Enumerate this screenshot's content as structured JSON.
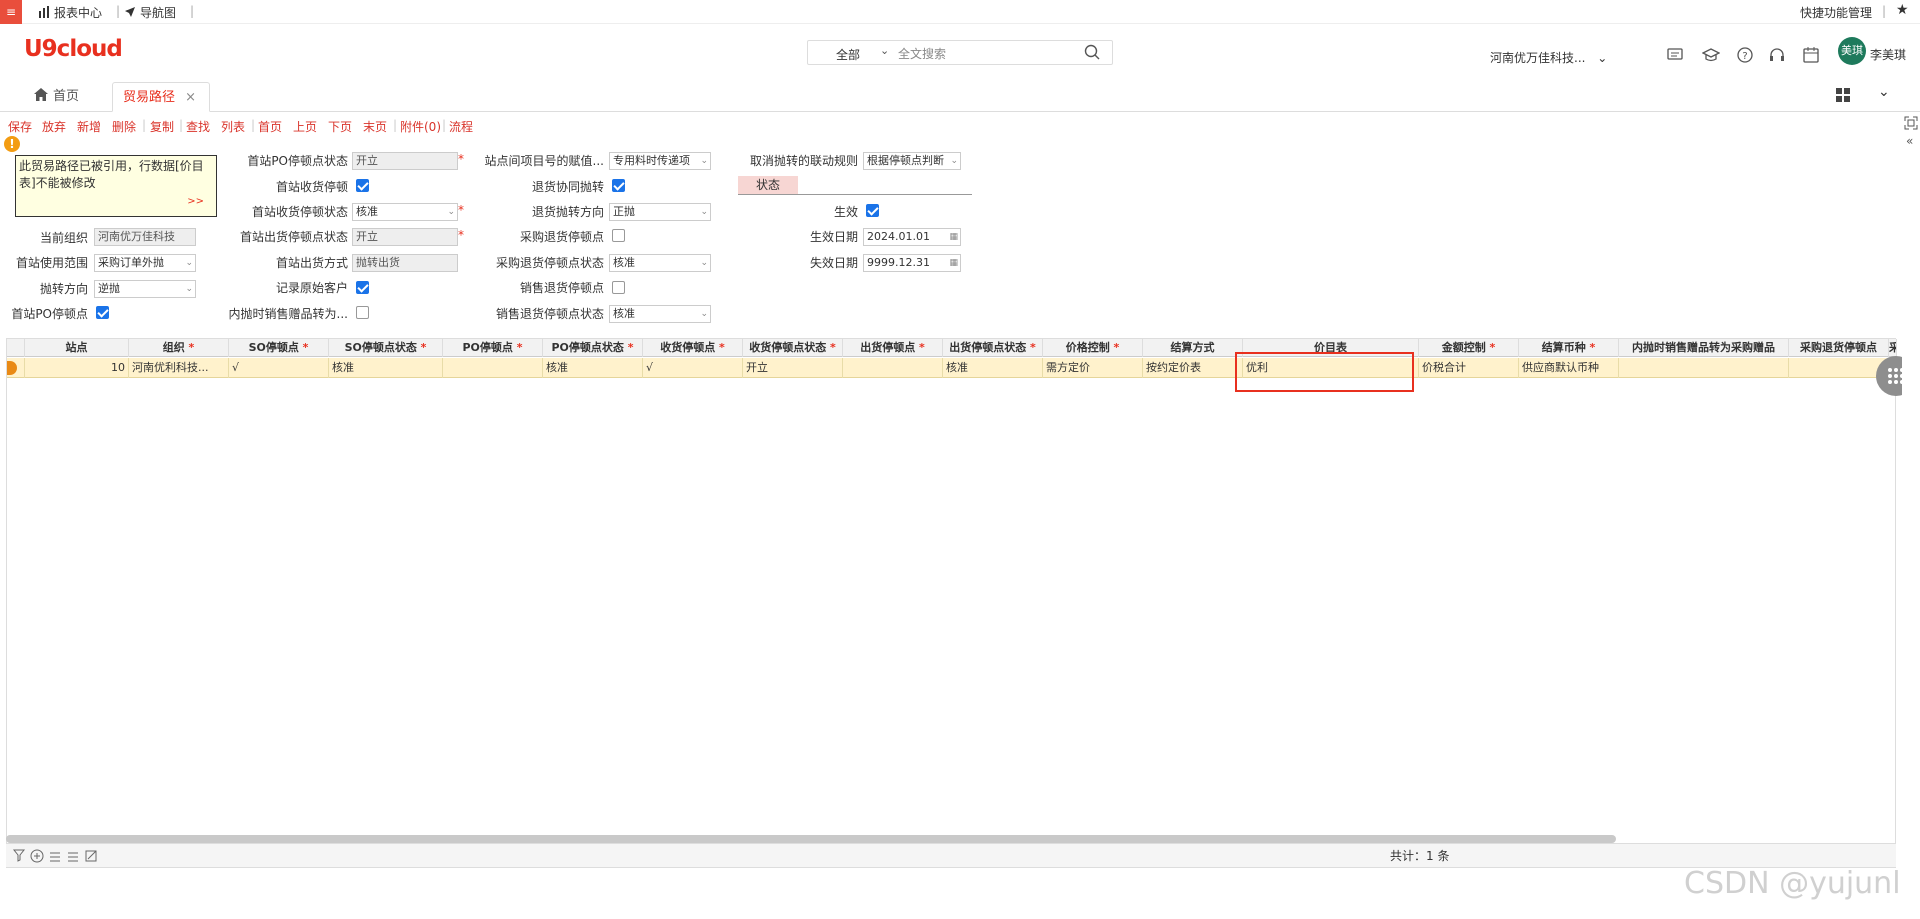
{
  "topbar": {
    "menu_icon": "≡",
    "reports": "报表中心",
    "nav": "导航图",
    "quick": "快捷功能管理",
    "star": "★"
  },
  "header": {
    "logo": "U9cloud",
    "search_scope": "全部",
    "search_placeholder": "全文搜索",
    "org": "河南优万佳科技...",
    "avatar_text": "美琪",
    "user": "李美琪"
  },
  "tabs": [
    {
      "label": "首页"
    },
    {
      "label": "贸易路径"
    }
  ],
  "toolbar": [
    "保存",
    "放弃",
    "新增",
    "删除",
    "复制",
    "查找",
    "列表",
    "首页",
    "上页",
    "下页",
    "末页",
    "附件(0)",
    "流程"
  ],
  "warning": {
    "text": "此贸易路径已被引用，行数据[价目表]不能被修改",
    "more": ">>"
  },
  "form": {
    "col1": {
      "current_org_label": "当前组织",
      "current_org": "河南优万佳科技",
      "first_use_label": "首站使用范围",
      "first_use": "采购订单外抛",
      "toss_dir_label": "抛转方向",
      "toss_dir": "逆抛",
      "first_po_stop_label": "首站PO停顿点"
    },
    "col2": {
      "po_stop_state_label": "首站PO停顿点状态",
      "po_stop_state": "开立",
      "recv_stop_label": "首站收货停顿",
      "recv_stop_state_label": "首站收货停顿状态",
      "recv_stop_state": "核准",
      "ship_stop_state_label": "首站出货停顿点状态",
      "ship_stop_state": "开立",
      "ship_mode_label": "首站出货方式",
      "ship_mode": "抛转出货",
      "record_cust_label": "记录原始客户",
      "inner_gift_label": "内抛时销售赠品转为..."
    },
    "col3": {
      "assign_label": "站点间项目号的赋值...",
      "assign": "专用料时传递项",
      "ret_collab_label": "退货协同抛转",
      "ret_dir_label": "退货抛转方向",
      "ret_dir": "正抛",
      "po_ret_stop_label": "采购退货停顿点",
      "po_ret_state_label": "采购退货停顿点状态",
      "po_ret_state": "核准",
      "so_ret_stop_label": "销售退货停顿点",
      "so_ret_state_label": "销售退货停顿点状态",
      "so_ret_state": "核准"
    },
    "col4": {
      "cancel_rule_label": "取消抛转的联动规则",
      "cancel_rule": "根据停顿点判断",
      "state_tab": "状态",
      "effective_label": "生效",
      "eff_date_label": "生效日期",
      "eff_date": "2024.01.01",
      "exp_date_label": "失效日期",
      "exp_date": "9999.12.31"
    }
  },
  "grid": {
    "headers": [
      "站点",
      "组织",
      "SO停顿点",
      "SO停顿点状态",
      "PO停顿点",
      "PO停顿点状态",
      "收货停顿点",
      "收货停顿点状态",
      "出货停顿点",
      "出货停顿点状态",
      "价格控制",
      "结算方式",
      "价目表",
      "金额控制",
      "结算币种",
      "内抛时销售赠品转为采购赠品",
      "采购退货停顿点",
      "采"
    ],
    "required": [
      false,
      true,
      true,
      true,
      true,
      true,
      true,
      true,
      true,
      true,
      true,
      false,
      false,
      true,
      true,
      false,
      false,
      false
    ],
    "row": [
      "10",
      "河南优利科技...",
      "√",
      "核准",
      "",
      "核准",
      "√",
      "开立",
      "",
      "核准",
      "需方定价",
      "按约定价表",
      "优利",
      "价税合计",
      "供应商默认币种",
      "",
      "",
      ""
    ]
  },
  "footer": {
    "count": "共计：1 条"
  },
  "watermark": "CSDN @yujunl"
}
